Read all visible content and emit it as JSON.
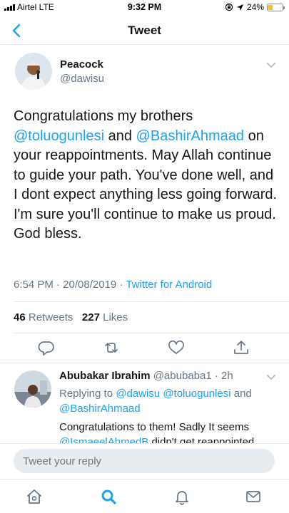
{
  "status_bar": {
    "carrier": "Airtel  LTE",
    "time": "9:32 PM",
    "battery": "24%",
    "battery_level": 0.24
  },
  "nav": {
    "title": "Tweet",
    "back_icon": "chevron-left-icon"
  },
  "tweet": {
    "author_name": "Peacock",
    "author_handle": "@dawisu",
    "text_parts": {
      "p1": "Congratulations my brothers ",
      "m1": "@toluogunlesi",
      "p2": " and ",
      "m2": "@BashirAhmaad",
      "p3": " on your reappointments. May Allah continue to guide your path. You've done well, and I dont expect anything less going forward. I'm sure you'll continue to make us proud. God bless."
    },
    "time": "6:54 PM · 20/08/2019 · ",
    "source": "Twitter for Android",
    "retweets_count": "46",
    "retweets_label": "Retweets",
    "likes_count": "227",
    "likes_label": "Likes"
  },
  "actions": [
    "reply-icon",
    "retweet-icon",
    "like-icon",
    "share-icon"
  ],
  "reply": {
    "author_name": "Abubakar Ibrahim",
    "author_handle": "@abubaba1",
    "time": "· 2h",
    "replying_prefix": "Replying to ",
    "replying_m1": "@dawisu",
    "replying_m2": "@toluogunlesi",
    "replying_and": " and",
    "replying_m3": "@BashirAhmaad",
    "text_line1": "Congratulations to them! Sadly It seems",
    "text_mention": "@IsmaeelAhmedB",
    "text_line2": " didn't get reappointed"
  },
  "compose": {
    "placeholder": "Tweet your reply"
  },
  "tabs": [
    "home-icon",
    "search-icon",
    "notifications-icon",
    "messages-icon"
  ],
  "colors": {
    "accent": "#1da1f2",
    "secondary_text": "#657786",
    "divider": "#e1e8ed"
  }
}
